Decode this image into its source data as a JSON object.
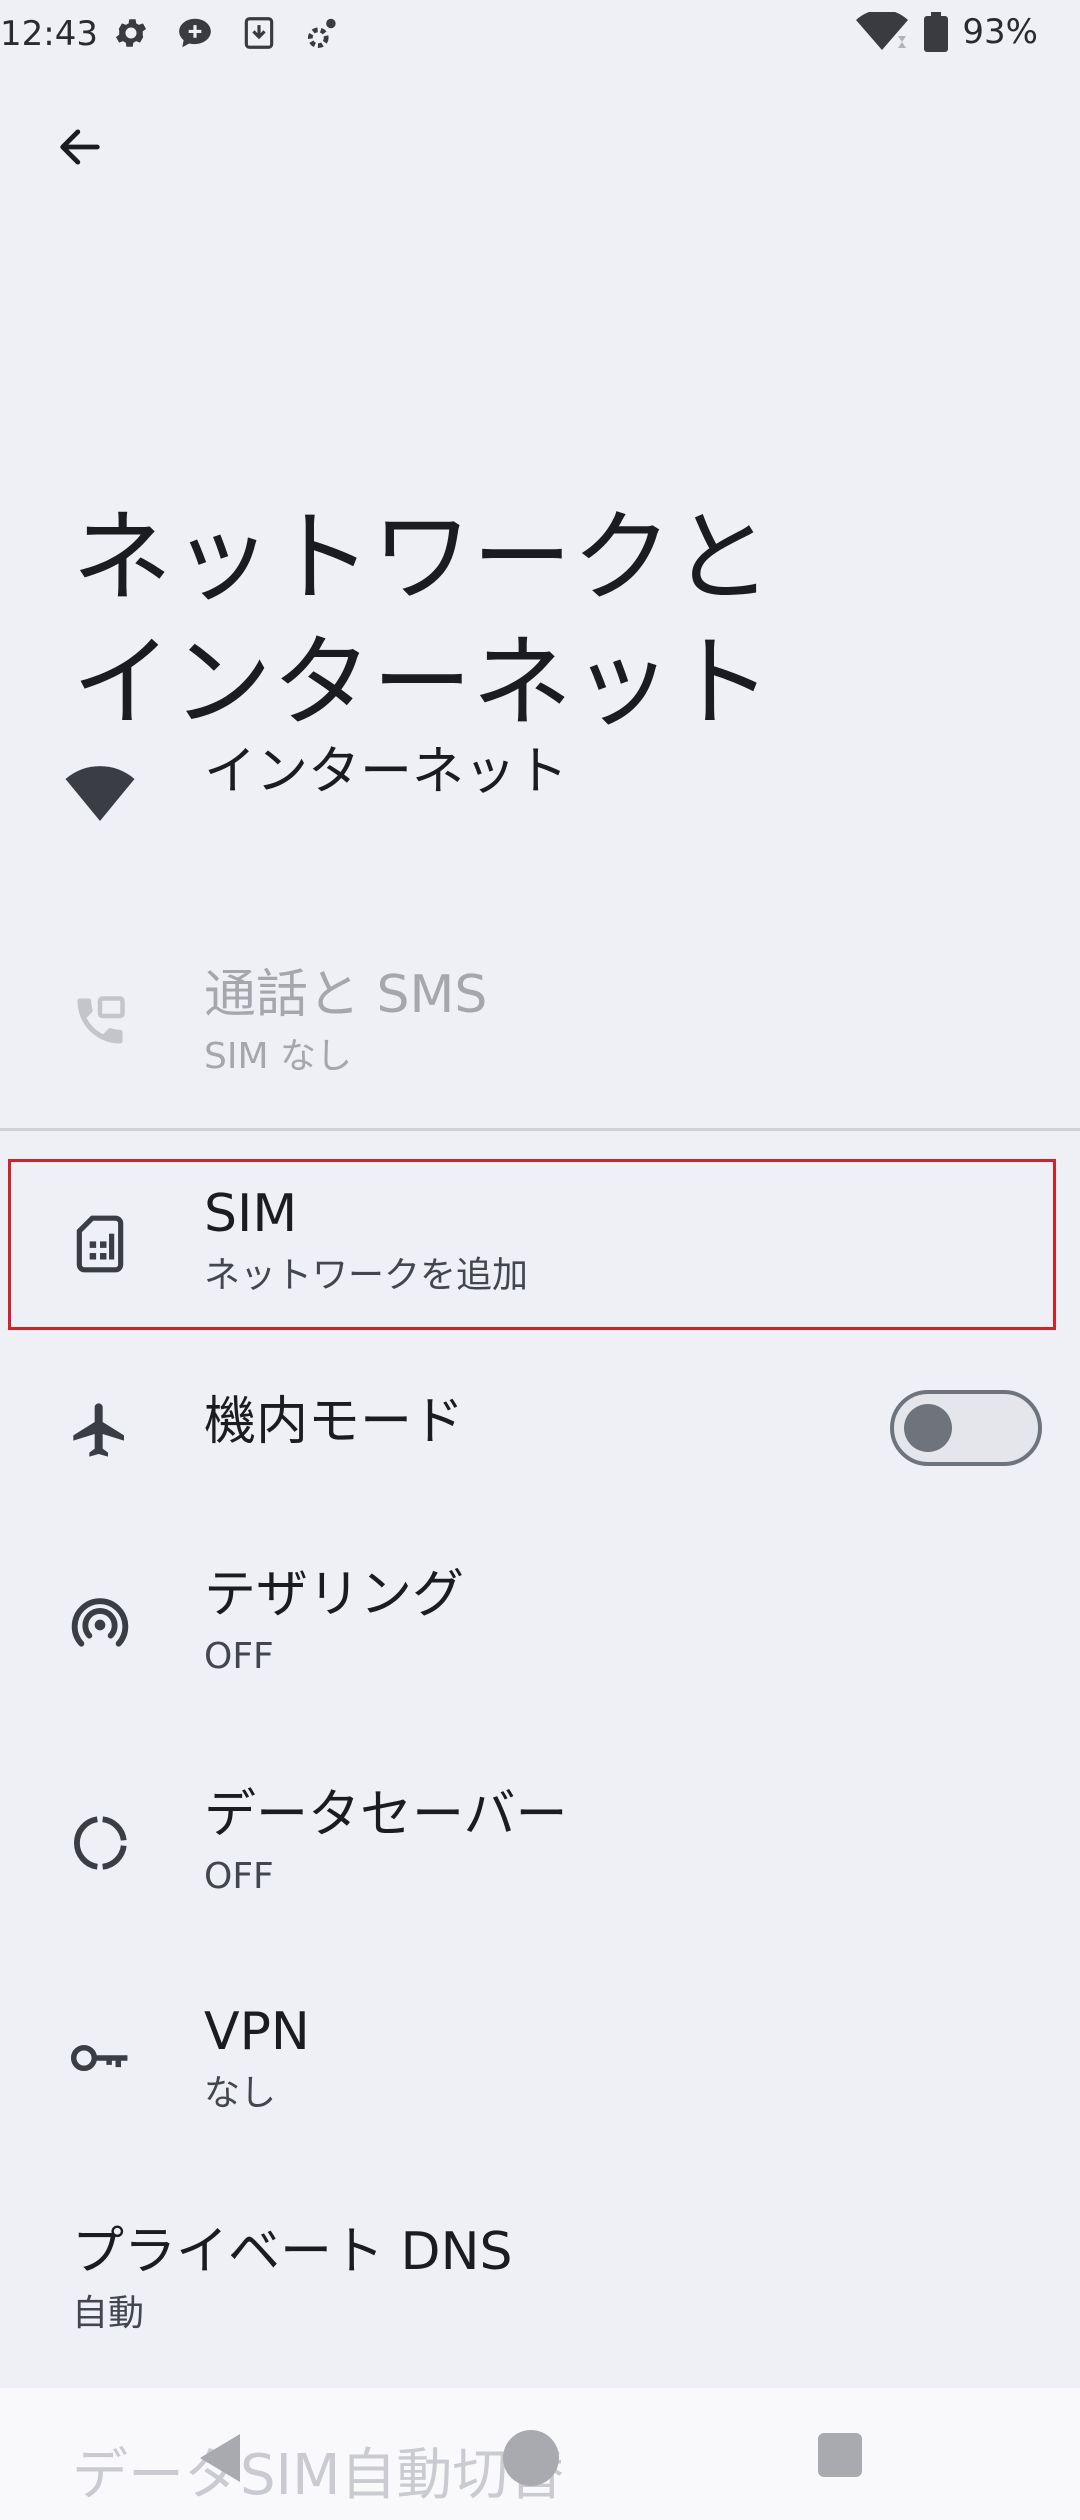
{
  "status_bar": {
    "time": "12:43",
    "battery_percent": "93%",
    "left_icons": [
      "gear-icon",
      "chat-add-icon",
      "download-icon",
      "settings-small-icon"
    ],
    "right_icons": [
      "wifi-icon",
      "battery-icon"
    ]
  },
  "header": {
    "back_icon": "arrow-left-icon",
    "title": "ネットワークと\nインターネット"
  },
  "settings": {
    "internet": {
      "title": "インターネット",
      "icon": "wifi-icon"
    },
    "calls_sms": {
      "title": "通話と SMS",
      "summary": "SIM なし",
      "icon": "phone-sms-icon",
      "disabled": true
    },
    "sim": {
      "title": "SIM",
      "summary": "ネットワークを追加",
      "icon": "sim-card-icon",
      "highlighted": true
    },
    "airplane": {
      "title": "機内モード",
      "icon": "airplane-icon",
      "toggle_on": false
    },
    "tethering": {
      "title": "テザリング",
      "summary": "OFF",
      "icon": "hotspot-icon"
    },
    "data_saver": {
      "title": "データセーバー",
      "summary": "OFF",
      "icon": "data-saver-icon"
    },
    "vpn": {
      "title": "VPN",
      "summary": "なし",
      "icon": "key-icon"
    },
    "private_dns": {
      "title": "プライベート DNS",
      "summary": "自動"
    },
    "data_sim_switch": {
      "title": "データSIM自動切替"
    }
  },
  "colors": {
    "background": "#eef0f6",
    "highlight": "#d6202a",
    "disabled_text": "#a5a7ad"
  }
}
